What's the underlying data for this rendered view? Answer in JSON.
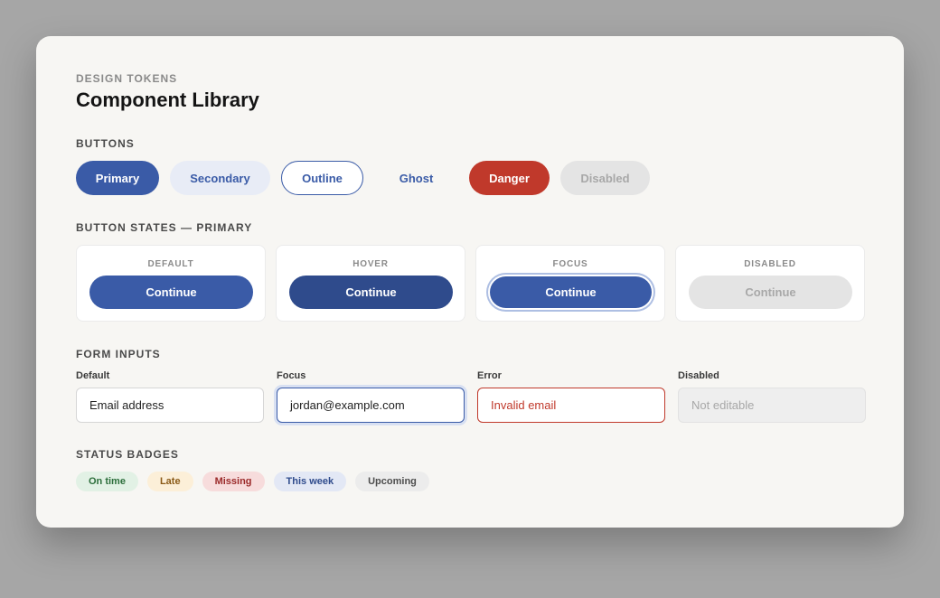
{
  "header": {
    "eyebrow": "DESIGN TOKENS",
    "title": "Component Library"
  },
  "buttons": {
    "section_label": "BUTTONS",
    "primary": "Primary",
    "secondary": "Secondary",
    "outline": "Outline",
    "ghost": "Ghost",
    "danger": "Danger",
    "disabled": "Disabled"
  },
  "states": {
    "section_label": "BUTTON STATES — PRIMARY",
    "items": [
      {
        "label": "DEFAULT",
        "button": "Continue"
      },
      {
        "label": "HOVER",
        "button": "Continue"
      },
      {
        "label": "FOCUS",
        "button": "Continue"
      },
      {
        "label": "DISABLED",
        "button": "Continue"
      }
    ]
  },
  "inputs": {
    "section_label": "FORM INPUTS",
    "items": [
      {
        "label": "Default",
        "value": "Email address"
      },
      {
        "label": "Focus",
        "value": "jordan@example.com"
      },
      {
        "label": "Error",
        "value": "Invalid email"
      },
      {
        "label": "Disabled",
        "value": "Not editable"
      }
    ]
  },
  "badges": {
    "section_label": "STATUS BADGES",
    "items": [
      "On time",
      "Late",
      "Missing",
      "This week",
      "Upcoming"
    ]
  },
  "colors": {
    "primary": "#3a5ba7",
    "primary_hover": "#2f4b8c",
    "danger": "#c0392b",
    "card_background": "#f7f6f3",
    "page_background": "#a6a6a6"
  }
}
